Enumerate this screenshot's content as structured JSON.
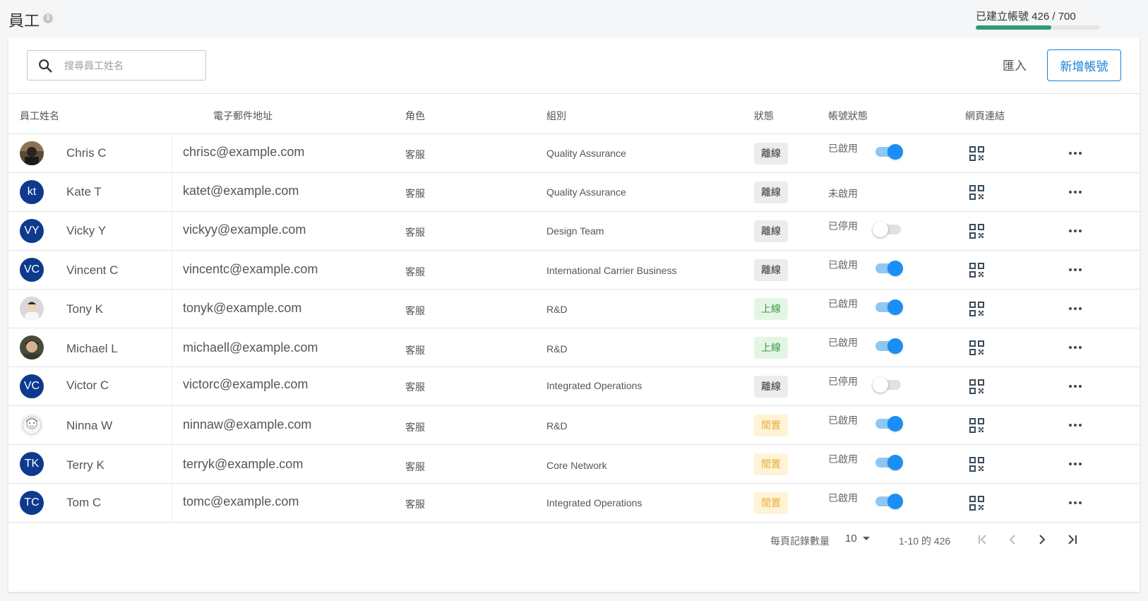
{
  "page": {
    "title": "員工",
    "info_icon": "info-icon",
    "quota_label": "已建立帳號 426 / 700",
    "quota_fraction": 0.608,
    "quota_color": "#2e9a73"
  },
  "toolbar": {
    "search_placeholder": "搜尋員工姓名",
    "search_value": "",
    "import_label": "匯入",
    "add_label": "新增帳號",
    "accent_color": "#1a7fd4"
  },
  "table": {
    "headers": {
      "name": "員工姓名",
      "email": "電子郵件地址",
      "role": "角色",
      "group": "組別",
      "status": "狀態",
      "account_status": "帳號狀態",
      "web_link": "網頁連結"
    },
    "rows": [
      {
        "avatar": "photo-1",
        "initials": "",
        "name": "Chris C",
        "email": "chrisc@example.com",
        "role": "客服",
        "group": "Quality Assurance",
        "status": "離線",
        "status_type": "offline",
        "account_status": "已啟用",
        "toggle": "on"
      },
      {
        "avatar": "initials",
        "initials": "kt",
        "name": "Kate T",
        "email": "katet@example.com",
        "role": "客服",
        "group": "Quality Assurance",
        "status": "離線",
        "status_type": "offline",
        "account_status": "未啟用",
        "toggle": "none"
      },
      {
        "avatar": "initials",
        "initials": "VY",
        "name": "Vicky Y",
        "email": "vickyy@example.com",
        "role": "客服",
        "group": "Design Team",
        "status": "離線",
        "status_type": "offline",
        "account_status": "已停用",
        "toggle": "off"
      },
      {
        "avatar": "initials",
        "initials": "VC",
        "name": "Vincent C",
        "email": "vincentc@example.com",
        "role": "客服",
        "group": "International Carrier Business",
        "status": "離線",
        "status_type": "offline",
        "account_status": "已啟用",
        "toggle": "on"
      },
      {
        "avatar": "photo-2",
        "initials": "",
        "name": "Tony K",
        "email": "tonyk@example.com",
        "role": "客服",
        "group": "R&D",
        "status": "上線",
        "status_type": "online",
        "account_status": "已啟用",
        "toggle": "on"
      },
      {
        "avatar": "photo-3",
        "initials": "",
        "name": "Michael L",
        "email": "michaell@example.com",
        "role": "客服",
        "group": "R&D",
        "status": "上線",
        "status_type": "online",
        "account_status": "已啟用",
        "toggle": "on"
      },
      {
        "avatar": "initials",
        "initials": "VC",
        "name": "Victor C",
        "email": "victorc@example.com",
        "role": "客服",
        "group": "Integrated Operations",
        "status": "離線",
        "status_type": "offline",
        "account_status": "已停用",
        "toggle": "off"
      },
      {
        "avatar": "photo-4",
        "initials": "",
        "name": "Ninna W",
        "email": "ninnaw@example.com",
        "role": "客服",
        "group": "R&D",
        "status": "閒置",
        "status_type": "idle",
        "account_status": "已啟用",
        "toggle": "on"
      },
      {
        "avatar": "initials",
        "initials": "TK",
        "name": "Terry K",
        "email": "terryk@example.com",
        "role": "客服",
        "group": "Core Network",
        "status": "閒置",
        "status_type": "idle",
        "account_status": "已啟用",
        "toggle": "on"
      },
      {
        "avatar": "initials",
        "initials": "TC",
        "name": "Tom C",
        "email": "tomc@example.com",
        "role": "客服",
        "group": "Integrated Operations",
        "status": "閒置",
        "status_type": "idle",
        "account_status": "已啟用",
        "toggle": "on"
      }
    ]
  },
  "pagination": {
    "rows_per_page_label": "每頁記錄數量",
    "rows_per_page_value": "10",
    "range_label": "1-10 的 426",
    "first_icon": "first-page-icon",
    "prev_icon": "prev-page-icon",
    "next_icon": "next-page-icon",
    "last_icon": "last-page-icon"
  },
  "colors": {
    "avatar_bg": "#0d3a8c",
    "toggle_on": "#1a8ef5",
    "status_online": "#3f9a4a",
    "status_idle": "#e4b13b"
  }
}
